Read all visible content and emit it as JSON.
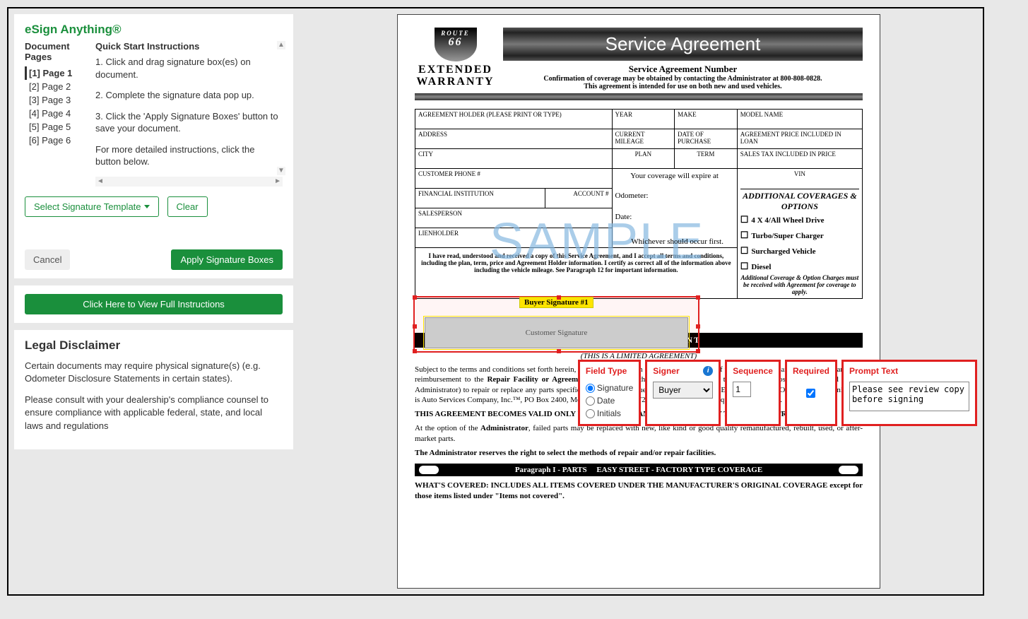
{
  "brand": "eSign Anything®",
  "sidebar": {
    "pages_heading": "Document Pages",
    "instructions_heading": "Quick Start Instructions",
    "pages": [
      "[1] Page 1",
      "[2] Page 2",
      "[3] Page 3",
      "[4] Page 4",
      "[5] Page 5",
      "[6] Page 6"
    ],
    "instructions": [
      "1. Click and drag signature box(es) on document.",
      "2. Complete the signature data pop up.",
      "3. Click the 'Apply Signature Boxes' button to save your document.",
      "For more detailed instructions, click the button below."
    ],
    "select_template_btn": "Select Signature Template",
    "clear_btn": "Clear",
    "cancel_btn": "Cancel",
    "apply_btn": "Apply Signature Boxes",
    "full_instructions_btn": "Click Here to View Full Instructions"
  },
  "legal": {
    "heading": "Legal Disclaimer",
    "p1": "Certain documents may require physical signature(s) (e.g. Odometer Disclosure Statements in certain states).",
    "p2": "Please consult with your dealership's compliance counsel to ensure compliance with applicable federal, state, and local laws and regulations"
  },
  "document": {
    "logo_route": "ROUTE",
    "logo_num": "66",
    "logo_ext1": "EXTENDED",
    "logo_ext2": "WARRANTY",
    "title": "Service Agreement",
    "subtitle": "Service Agreement Number",
    "conf": "Confirmation of coverage may be obtained by contacting the Administrator at 800-808-0828.",
    "intent": "This agreement is intended for use on both new and used vehicles.",
    "watermark": "SAMPLE",
    "fields": {
      "holder": "AGREEMENT HOLDER (PLEASE PRINT OR TYPE)",
      "year": "YEAR",
      "make": "MAKE",
      "model": "MODEL NAME",
      "address": "ADDRESS",
      "mileage": "CURRENT MILEAGE",
      "dop": "DATE OF PURCHASE",
      "loan": "AGREEMENT PRICE INCLUDED IN LOAN",
      "city": "CITY",
      "plan": "PLAN",
      "term": "TERM",
      "tax": "SALES TAX INCLUDED IN PRICE",
      "phone": "CUSTOMER PHONE #",
      "expire": "Your coverage will expire at",
      "vin": "VIN",
      "fin": "FINANCIAL INSTITUTION",
      "acct": "ACCOUNT #",
      "odo": "Odometer:",
      "sales": "SALESPERSON",
      "date": "Date:",
      "lien": "LIENHOLDER",
      "which": "Whichever should occur first."
    },
    "coverages": {
      "heading": "ADDITIONAL COVERAGES & OPTIONS",
      "opts": [
        "4 X 4/All Wheel Drive",
        "Turbo/Super Charger",
        "Surcharged Vehicle",
        "Diesel"
      ],
      "note": "Additional Coverage & Option Charges must be received with Agreement for coverage to apply."
    },
    "ack": "I have read, understood and received a copy of this Service Agreement, and I accept all terms and conditions, including the plan, term, price and Agreement Holder information. I certify as correct all of the information above including the vehicle mileage. See Paragraph 12 for important information.",
    "sig_box_label": "Buyer Signature #1",
    "sig_placeholder": "Customer Signature",
    "scope_bar": "SCOPE OF AGREEMENT",
    "limited": "(THIS IS A LIMITED AGREEMENT)",
    "body1a": "Subject to the terms and conditions set forth herein, the Administrator, in exchange for payment of the appropriate charge, agrees to arrange for reimbursement to the ",
    "body1_bold1": "Repair Facility or Agreement Holder",
    "body1b": " up to the limits of liability for the ",
    "body1_bold2": "reasonable",
    "body1c": " cost (as determined by the Administrator) to repair or replace any parts specified in Paragraph 1 due to MECHANICAL BREAKDOWN. The Obligor and Administrator is Auto Services Company, Inc.™, PO Box 2400, Mountain Home, AR  72654, unless otherwise required by State law.",
    "valid": "THIS AGREEMENT BECOMES VALID ONLY UPON RECEIPT AND ACCEPTANCE BY THE ADMINISTRATOR.",
    "body2a": "At the option of the ",
    "body2_bold": "Administrator",
    "body2b": ", failed parts may be replaced with new, like kind or good quality remanufactured, rebuilt, used, or after-market parts.",
    "body3": "The Administrator reserves the right to select the methods of repair and/or repair facilities.",
    "para_bar_l": "Paragraph I - PARTS",
    "para_bar_r": "EASY STREET - FACTORY TYPE COVERAGE",
    "covered": "WHAT'S COVERED: INCLUDES ALL ITEMS COVERED UNDER THE MANUFACTURER'S ORIGINAL COVERAGE except for those items listed under \"Items not covered\"."
  },
  "popup": {
    "field_type_h": "Field Type",
    "field_types": [
      "Signature",
      "Date",
      "Initials"
    ],
    "field_type_selected": "Signature",
    "signer_h": "Signer",
    "signer_options": [
      "Buyer"
    ],
    "signer_selected": "Buyer",
    "sequence_h": "Sequence",
    "sequence_value": "1",
    "required_h": "Required",
    "required_checked": true,
    "prompt_h": "Prompt Text",
    "prompt_value": "Please see review copy before signing"
  }
}
